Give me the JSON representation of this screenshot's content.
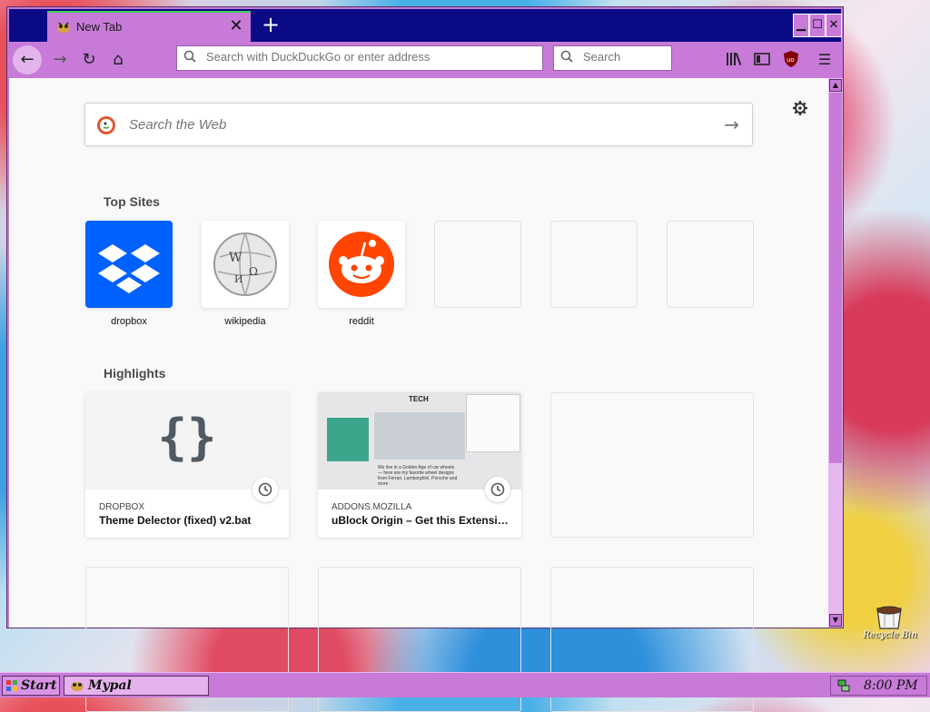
{
  "browser": {
    "tab": {
      "title": "New Tab",
      "close": "✕"
    },
    "new_tab": "+",
    "window_controls": {
      "minimize": "▁",
      "maximize": "☐",
      "close": "✕"
    },
    "nav": {
      "back": "←",
      "forward": "→",
      "reload": "↻",
      "home": "⌂"
    },
    "urlbar": {
      "placeholder": "Search with DuckDuckGo or enter address"
    },
    "searchbar": {
      "placeholder": "Search"
    },
    "toolbar_icons": [
      "library-icon",
      "sidebar-icon",
      "ublock-icon",
      "menu-icon"
    ],
    "menu": "☰"
  },
  "newtab": {
    "search": {
      "placeholder": "Search the Web",
      "go": "→"
    },
    "top_sites": {
      "title": "Top Sites",
      "sites": [
        {
          "label": "dropbox",
          "icon": "dropbox-icon",
          "color": "#0061fe"
        },
        {
          "label": "wikipedia",
          "icon": "wikipedia-icon",
          "color": "#ffffff"
        },
        {
          "label": "reddit",
          "icon": "reddit-icon",
          "color": "#ff4500"
        }
      ]
    },
    "highlights": {
      "title": "Highlights",
      "cards": [
        {
          "source": "DROPBOX",
          "title": "Theme Delector (fixed) v2.bat",
          "thumb_icon": "code-braces-icon",
          "thumb_text": "{}"
        },
        {
          "source": "ADDONS.MOZILLA",
          "title": "uBlock Origin – Get this Extensio...",
          "thumb_text": "TECH",
          "thumb_caption": "We live in a Golden Age of car wheels — here are my favorite wheel designs from Ferrari, Lamborghini, Porsche and more"
        }
      ]
    }
  },
  "taskbar": {
    "start": "Start",
    "task": "Mypal",
    "time": "8:00 PM"
  },
  "desktop": {
    "recycle_bin": "Recycle Bin"
  },
  "colors": {
    "window_frame": "#c77ad8",
    "titlebar": "#0a0a84",
    "accent_tab": "#3ecf5a",
    "dropbox": "#0061fe",
    "reddit": "#ff4500"
  }
}
